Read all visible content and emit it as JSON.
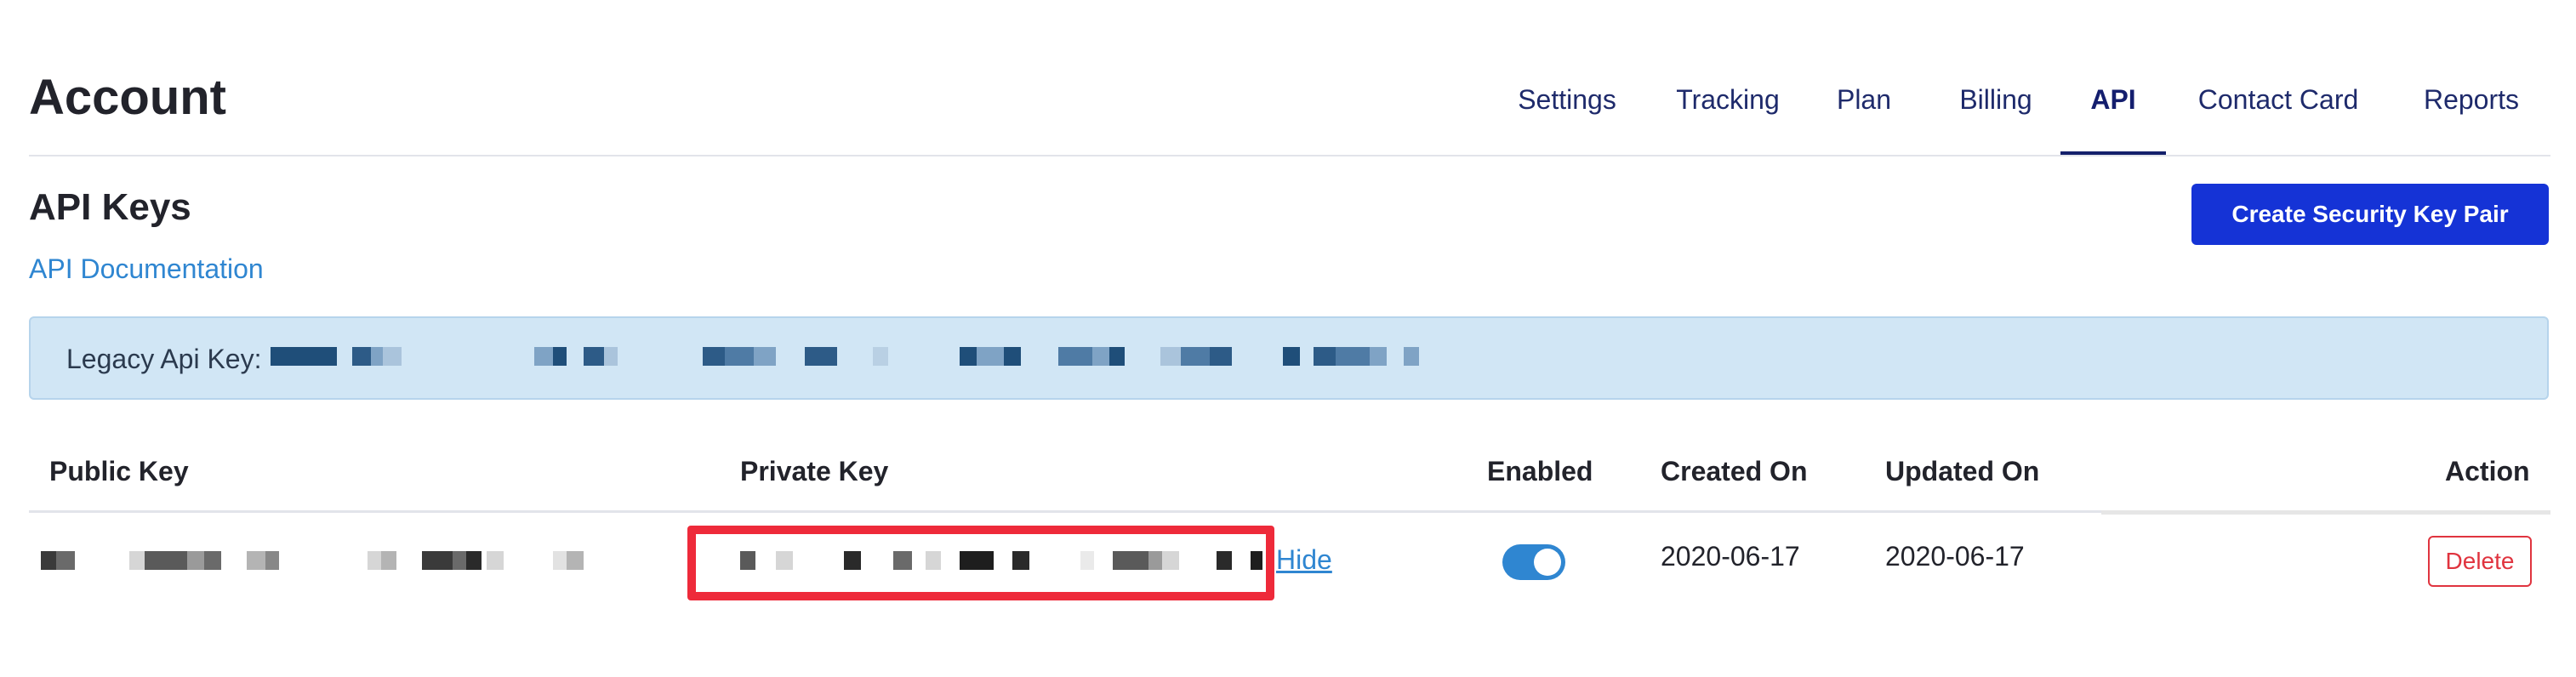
{
  "page": {
    "title": "Account"
  },
  "nav": {
    "tabs": [
      {
        "label": "Settings"
      },
      {
        "label": "Tracking"
      },
      {
        "label": "Plan"
      },
      {
        "label": "Billing"
      },
      {
        "label": "API",
        "active": true
      },
      {
        "label": "Contact Card"
      },
      {
        "label": "Reports"
      }
    ]
  },
  "api_keys": {
    "title": "API Keys",
    "doc_link": "API Documentation",
    "create_button": "Create Security Key Pair",
    "legacy_label": "Legacy Api Key:"
  },
  "table": {
    "columns": {
      "public_key": "Public Key",
      "private_key": "Private Key",
      "enabled": "Enabled",
      "created_on": "Created On",
      "updated_on": "Updated On",
      "action": "Action"
    },
    "rows": [
      {
        "hide_label": "Hide",
        "enabled": true,
        "created_on": "2020-06-17",
        "updated_on": "2020-06-17",
        "delete_label": "Delete"
      }
    ]
  },
  "colors": {
    "primary": "#1533d6",
    "link": "#2f86d1",
    "info_bg": "#d1e6f5",
    "danger": "#e0343f",
    "highlight": "#ee2a3a"
  }
}
